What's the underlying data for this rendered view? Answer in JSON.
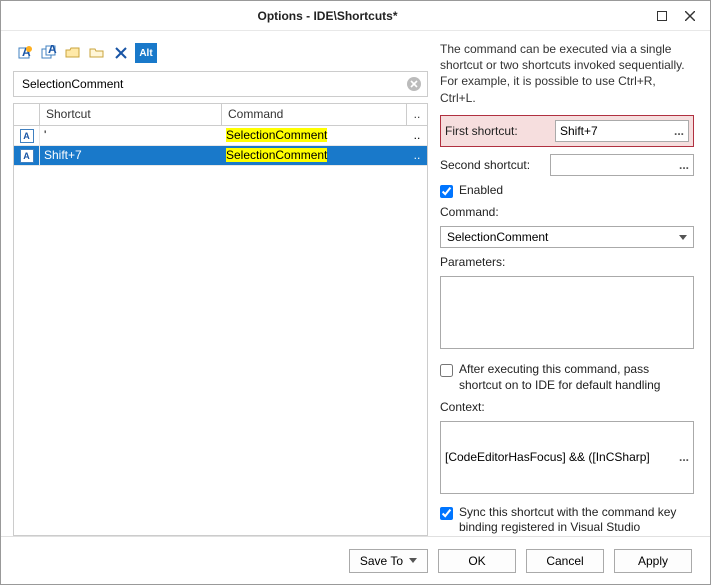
{
  "title": "Options - IDE\\Shortcuts*",
  "toolbarAltLabel": "Alt",
  "search": {
    "value": "SelectionComment"
  },
  "grid": {
    "headers": {
      "shortcut": "Shortcut",
      "command": "Command",
      "dots": ".."
    },
    "rows": [
      {
        "shortcut": "'",
        "command": "SelectionComment",
        "selected": false
      },
      {
        "shortcut": "Shift+7",
        "command": "SelectionComment",
        "selected": true
      }
    ]
  },
  "right": {
    "description": "The command can be executed via a single shortcut or two shortcuts invoked sequentially. For example, it is possible to use Ctrl+R, Ctrl+L.",
    "firstShortcutLabel": "First shortcut:",
    "firstShortcutValue": "Shift+7",
    "secondShortcutLabel": "Second shortcut:",
    "secondShortcutValue": "",
    "enabledLabel": "Enabled",
    "enabledChecked": true,
    "commandLabel": "Command:",
    "commandValue": "SelectionComment",
    "parametersLabel": "Parameters:",
    "parametersValue": "",
    "passOnLabel": "After executing this command, pass shortcut on to IDE for default handling",
    "passOnChecked": false,
    "contextLabel": "Context:",
    "contextValue": "[CodeEditorHasFocus] && ([InCSharp]",
    "contextDots": "...",
    "syncLabel": "Sync this shortcut with the command key binding registered in Visual Studio",
    "syncChecked": true
  },
  "footer": {
    "saveTo": "Save To",
    "ok": "OK",
    "cancel": "Cancel",
    "apply": "Apply"
  }
}
